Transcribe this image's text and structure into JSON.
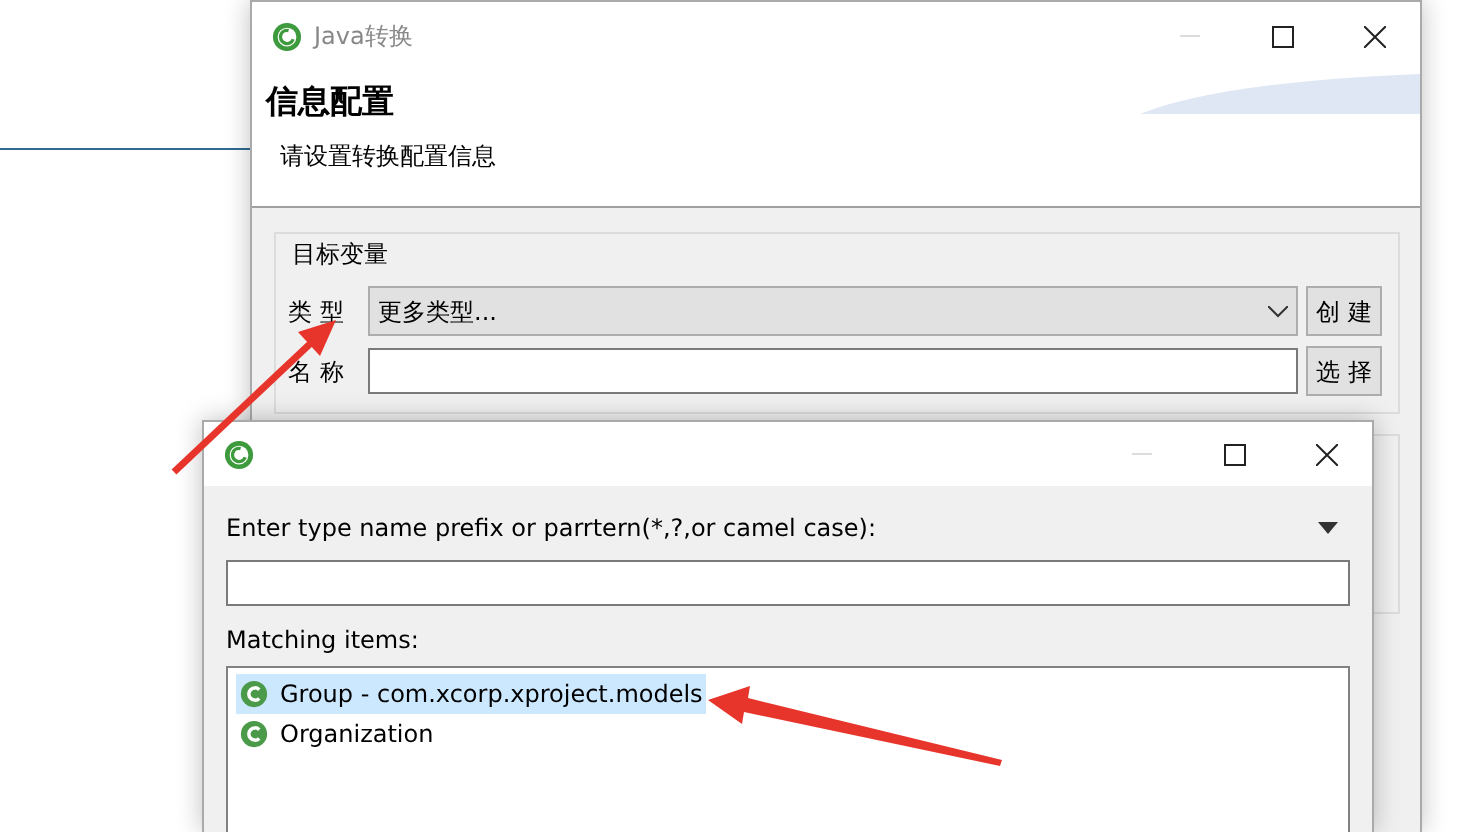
{
  "main_window": {
    "title": "Java转换",
    "header_title": "信息配置",
    "header_subtitle": "请设置转换配置信息",
    "group": {
      "label": "目标变量",
      "fields": [
        {
          "label": "类 型",
          "kind": "combo",
          "value": "更多类型...",
          "button": "创 建"
        },
        {
          "label": "名 称",
          "kind": "text",
          "button": "选 择"
        }
      ]
    }
  },
  "dialog": {
    "prompt": "Enter type name prefix or parrtern(*,?,or camel case):",
    "list_label": "Matching items:",
    "items": [
      {
        "label": "Group - com.xcorp.xproject.models",
        "selected": true
      },
      {
        "label": "Organization",
        "selected": false
      }
    ]
  }
}
